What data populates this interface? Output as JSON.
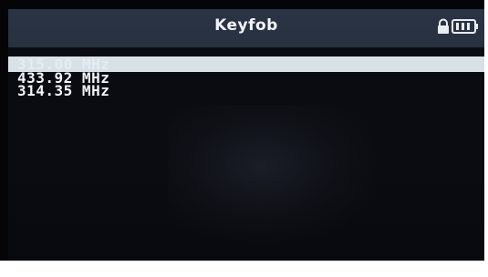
{
  "header": {
    "title": "Keyfob",
    "icons": [
      "lock-icon",
      "battery-icon"
    ]
  },
  "frequency_list": {
    "items": [
      {
        "label": "315.00 MHz",
        "selected": true
      },
      {
        "label": "433.92 MHz",
        "selected": false
      },
      {
        "label": "314.35 MHz",
        "selected": false
      }
    ]
  },
  "colors": {
    "header_bg": "#27313f",
    "screen_bg": "#0a0c12",
    "highlight": "#d8e0e8",
    "text": "#f3f5f8"
  }
}
